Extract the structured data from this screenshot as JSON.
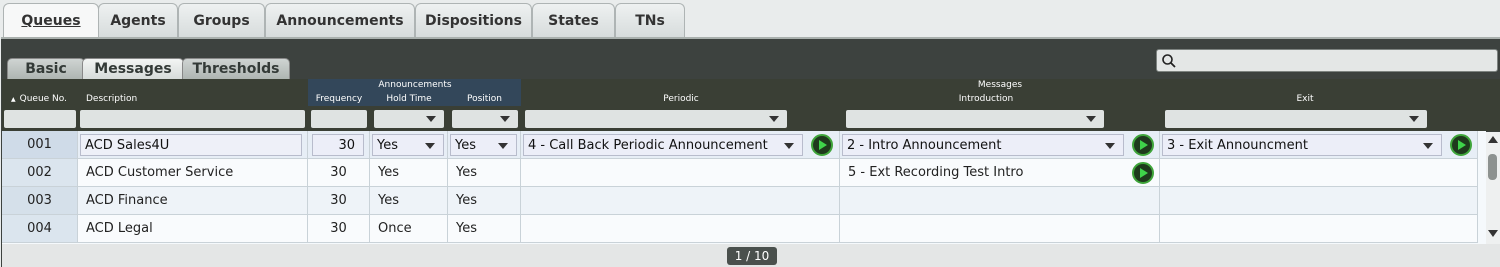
{
  "top_tabs": [
    "Queues",
    "Agents",
    "Groups",
    "Announcements",
    "Dispositions",
    "States",
    "TNs"
  ],
  "sub_tabs": [
    "Basic",
    "Messages",
    "Thresholds"
  ],
  "search": {
    "placeholder": ""
  },
  "headers": {
    "queue_no": "Queue No.",
    "description": "Description",
    "frequency": "Frequency",
    "announcements_group": "Announcements",
    "hold_time": "Hold Time",
    "position": "Position",
    "periodic": "Periodic",
    "messages_group": "Messages",
    "introduction": "Introduction",
    "exit": "Exit"
  },
  "rows": [
    {
      "queue_no": "001",
      "description": "ACD Sales4U",
      "frequency": "30",
      "hold_time": "Yes",
      "position": "Yes",
      "periodic": "4 - Call Back Periodic Announcement",
      "introduction": "2 - Intro Announcement",
      "exit": "3 - Exit Announcment"
    },
    {
      "queue_no": "002",
      "description": "ACD Customer Service",
      "frequency": "30",
      "hold_time": "Yes",
      "position": "Yes",
      "periodic": "",
      "introduction": "5 - Ext Recording Test Intro",
      "exit": ""
    },
    {
      "queue_no": "003",
      "description": "ACD Finance",
      "frequency": "30",
      "hold_time": "Yes",
      "position": "Yes",
      "periodic": "",
      "introduction": "",
      "exit": ""
    },
    {
      "queue_no": "004",
      "description": "ACD Legal",
      "frequency": "30",
      "hold_time": "Once",
      "position": "Yes",
      "periodic": "",
      "introduction": "",
      "exit": ""
    }
  ],
  "pager": {
    "text": "1 / 10"
  }
}
